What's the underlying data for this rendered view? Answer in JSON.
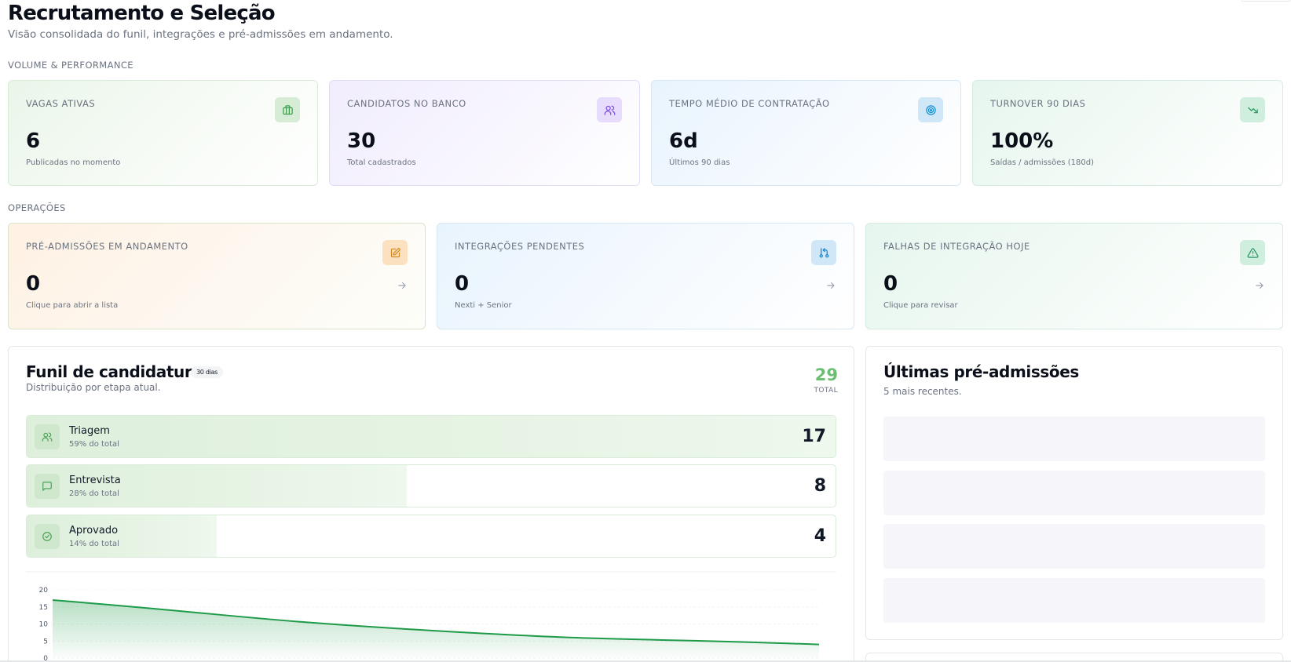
{
  "header": {
    "title": "Recrutamento e Seleção",
    "subtitle": "Visão consolidada do funil, integrações e pré-admissões em andamento."
  },
  "sections": {
    "volume": "VOLUME & PERFORMANCE",
    "operations": "OPERAÇÕES"
  },
  "kpis": [
    {
      "label": "VAGAS ATIVAS",
      "value": "6",
      "caption": "Publicadas no momento",
      "icon": "briefcase-icon",
      "accent": "#3f9d4e"
    },
    {
      "label": "CANDIDATOS NO BANCO",
      "value": "30",
      "caption": "Total cadastrados",
      "icon": "users-icon",
      "accent": "#7c4ddb"
    },
    {
      "label": "TEMPO MÉDIO DE CONTRATAÇÃO",
      "value": "6d",
      "caption": "Últimos 90 dias",
      "icon": "target-icon",
      "accent": "#1a8fd1"
    },
    {
      "label": "TURNOVER 90 DIAS",
      "value": "100%",
      "caption": "Saídas / admissões (180d)",
      "icon": "trending-down-icon",
      "accent": "#2c9a63"
    }
  ],
  "operations": [
    {
      "label": "PRÉ-ADMISSÕES EM ANDAMENTO",
      "value": "0",
      "caption": "Clique para abrir a lista",
      "icon": "edit-document-icon",
      "accent": "#d98a1f"
    },
    {
      "label": "INTEGRAÇÕES PENDENTES",
      "value": "0",
      "caption": "Nexti + Senior",
      "icon": "git-pull-request-icon",
      "accent": "#1a86c7"
    },
    {
      "label": "FALHAS DE INTEGRAÇÃO HOJE",
      "value": "0",
      "caption": "Clique para revisar",
      "icon": "alert-triangle-icon",
      "accent": "#2c9a63"
    }
  ],
  "funnel": {
    "title": "Funil de candidaturas",
    "period_badge": "30 dias",
    "subtitle": "Distribuição por etapa atual.",
    "total_value": "29",
    "total_label": "TOTAL",
    "stages": [
      {
        "name": "Triagem",
        "pct_label": "59% do total",
        "count": "17",
        "fraction": 1.0,
        "icon": "users-icon"
      },
      {
        "name": "Entrevista",
        "pct_label": "28% do total",
        "count": "8",
        "fraction": 0.47,
        "icon": "message-square-icon"
      },
      {
        "name": "Aprovado",
        "pct_label": "14% do total",
        "count": "4",
        "fraction": 0.235,
        "icon": "check-circle-icon"
      }
    ]
  },
  "chart_data": {
    "type": "area",
    "x": [
      0,
      1,
      2
    ],
    "values": [
      17,
      8,
      4
    ],
    "yticks": [
      "0",
      "5",
      "10",
      "15",
      "20"
    ],
    "ylim": [
      0,
      20
    ],
    "color": "#1e9a48",
    "grid": true
  },
  "pre_admissions": {
    "title": "Últimas pré-admissões",
    "subtitle": "5 mais recentes."
  }
}
